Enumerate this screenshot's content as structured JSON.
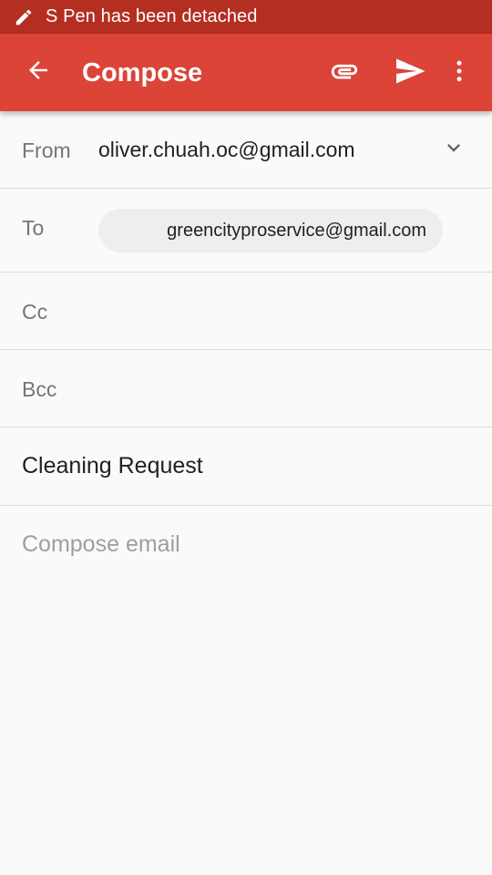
{
  "status_bar": {
    "icon": "pen-icon",
    "text": "S Pen has been detached"
  },
  "app_bar": {
    "back_icon": "arrow-back-icon",
    "title": "Compose",
    "attach_icon": "paperclip-icon",
    "send_icon": "send-icon",
    "more_icon": "more-vert-icon"
  },
  "form": {
    "from": {
      "label": "From",
      "value": "oliver.chuah.oc@gmail.com",
      "dropdown_icon": "chevron-down-icon"
    },
    "to": {
      "label": "To",
      "recipients": [
        "greencityproservice@gmail.com"
      ]
    },
    "cc": {
      "label": "Cc",
      "value": ""
    },
    "bcc": {
      "label": "Bcc",
      "value": ""
    },
    "subject": {
      "value": "Cleaning Request"
    },
    "body": {
      "placeholder": "Compose email",
      "value": ""
    }
  },
  "colors": {
    "status_bar": "#b52e22",
    "app_bar": "#db4437",
    "background": "#fafafa",
    "chip": "#eeeeee",
    "label": "#757575",
    "placeholder": "#9e9e9e",
    "divider": "#dcdcdc"
  }
}
